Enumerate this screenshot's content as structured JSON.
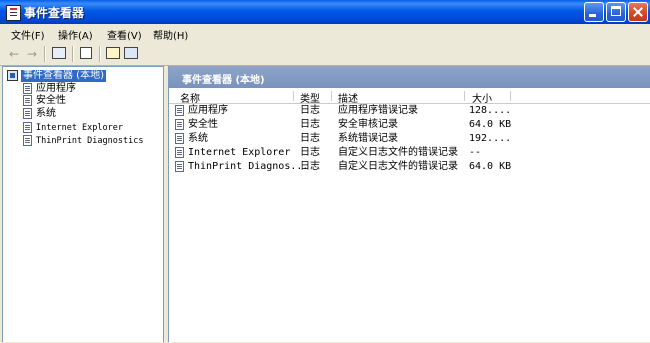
{
  "window": {
    "title": "事件查看器"
  },
  "menu": [
    {
      "label": "文件(F)"
    },
    {
      "label": "操作(A)"
    },
    {
      "label": "查看(V)"
    },
    {
      "label": "帮助(H)"
    }
  ],
  "toolbar": {
    "back_glyph": "←",
    "forward_glyph": "→",
    "buttons": [
      "show-hide-tree-icon",
      "export-list-icon",
      "properties-icon",
      "help-icon"
    ]
  },
  "tree": {
    "root_label": "事件查看器 (本地)",
    "items": [
      {
        "label": "应用程序"
      },
      {
        "label": "安全性"
      },
      {
        "label": "系统"
      },
      {
        "label": "Internet Explorer"
      },
      {
        "label": "ThinPrint Diagnostics"
      }
    ]
  },
  "main": {
    "header_title": "事件查看器 (本地)",
    "columns": [
      "名称",
      "类型",
      "描述",
      "大小"
    ],
    "rows": [
      {
        "name": "应用程序",
        "type": "日志",
        "desc": "应用程序错误记录",
        "size": "128...."
      },
      {
        "name": "安全性",
        "type": "日志",
        "desc": "安全审核记录",
        "size": "64.0 KB"
      },
      {
        "name": "系统",
        "type": "日志",
        "desc": "系统错误记录",
        "size": "192...."
      },
      {
        "name": "Internet Explorer",
        "type": "日志",
        "desc": "自定义日志文件的错误记录",
        "size": "--"
      },
      {
        "name": "ThinPrint Diagnos...",
        "type": "日志",
        "desc": "自定义日志文件的错误记录",
        "size": "64.0 KB"
      }
    ]
  },
  "colors": {
    "title_blue": "#0058e6",
    "selection": "#316ac5",
    "pane_header": "#7a93bd"
  }
}
